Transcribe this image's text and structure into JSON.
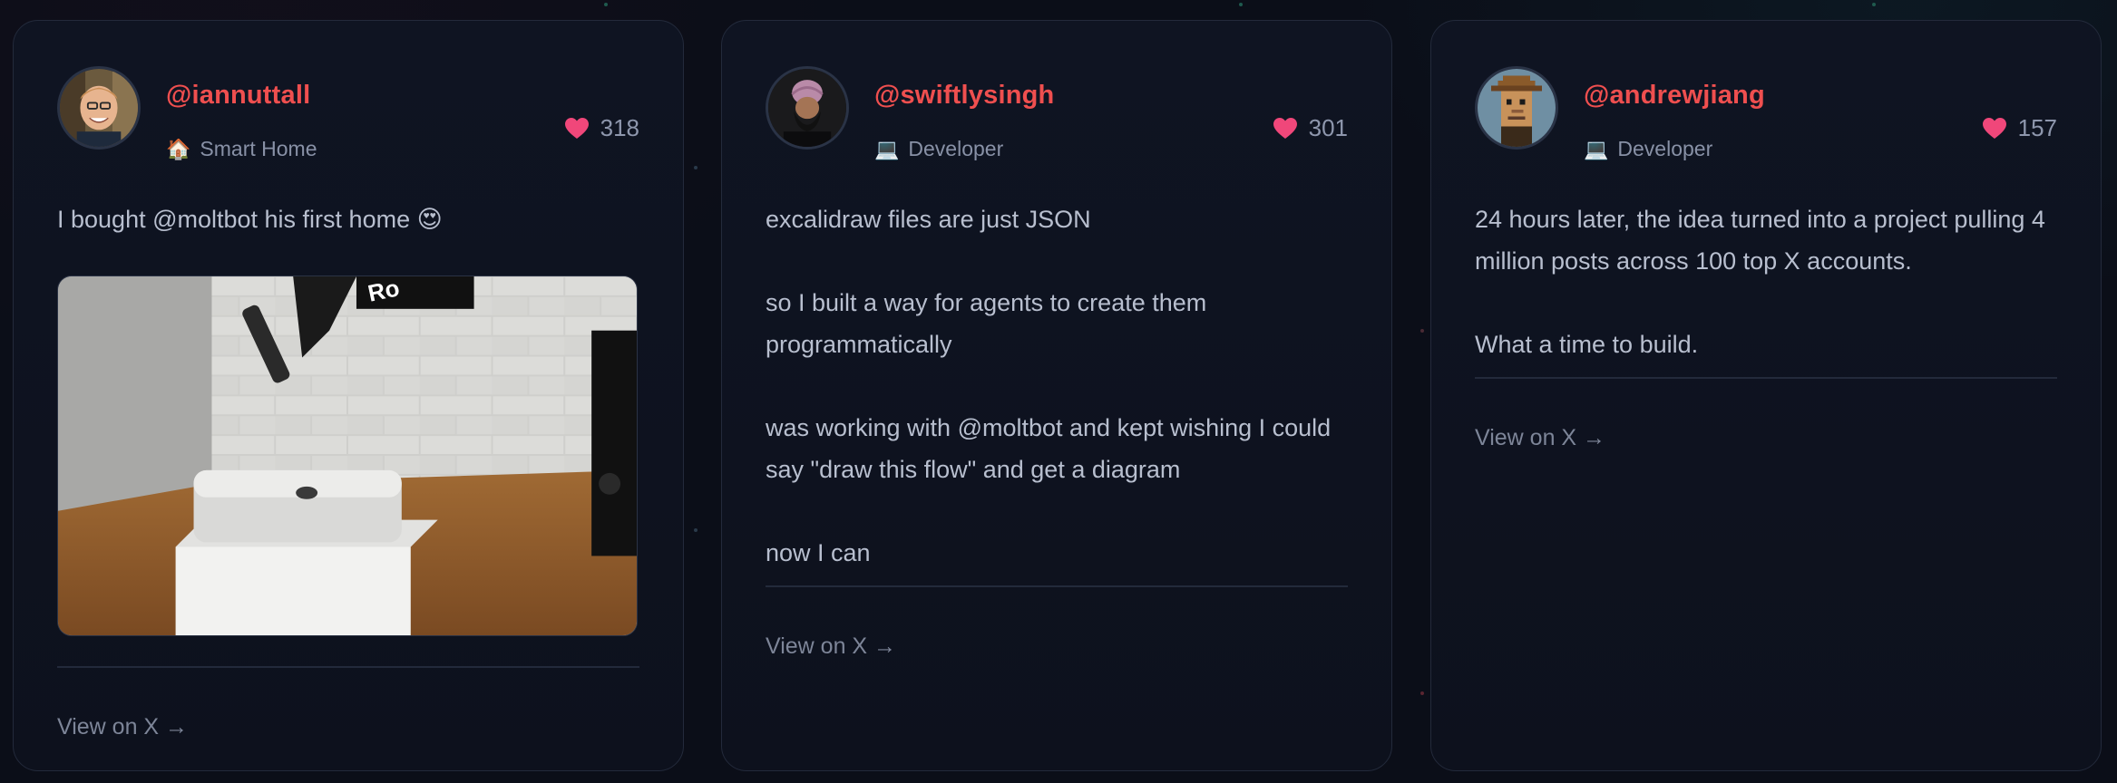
{
  "cards": [
    {
      "handle": "@iannuttall",
      "role_icon": "🏠",
      "role": "Smart Home",
      "likes": "318",
      "paragraphs": [
        "I bought @moltbot his first home 😍"
      ],
      "image": "photo-mac-mini-on-desk-with-robot-arm",
      "view_link": "View on X →"
    },
    {
      "handle": "@swiftlysingh",
      "role_icon": "💻",
      "role": "Developer",
      "likes": "301",
      "paragraphs": [
        "excalidraw files are just JSON",
        "so I built a way for agents to create them programmatically",
        "was working with @moltbot and kept wishing I could say \"draw this flow\" and get a diagram",
        "now I can"
      ],
      "view_link": "View on X →"
    },
    {
      "handle": "@andrewjiang",
      "role_icon": "💻",
      "role": "Developer",
      "likes": "157",
      "paragraphs": [
        "24 hours later, the idea turned into a project pulling 4 million posts across 100 top X accounts.",
        "What a time to build."
      ],
      "view_link": "View on X →"
    }
  ],
  "colors": {
    "handle": "#ef4f4f",
    "heart": "#f0477a",
    "background": "#0b0e18",
    "card_border": "#232a3b"
  },
  "icons": {
    "like": "heart-icon",
    "smart_home": "house-icon",
    "developer": "laptop-icon"
  }
}
